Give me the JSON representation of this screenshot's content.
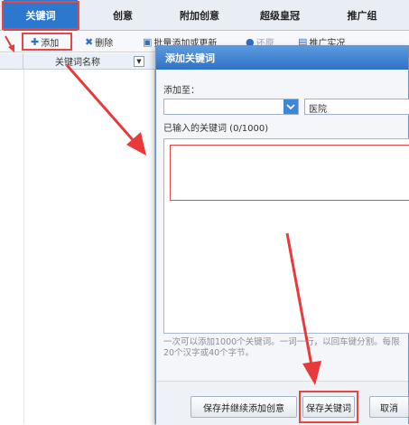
{
  "tabs": [
    {
      "label": "关键词",
      "active": true
    },
    {
      "label": "创意",
      "active": false
    },
    {
      "label": "附加创意",
      "active": false
    },
    {
      "label": "超级皇冠",
      "active": false
    },
    {
      "label": "推广组",
      "active": false
    }
  ],
  "toolbar": {
    "add_label": "添加",
    "add_icon": "plus-icon",
    "delete_label": "删除",
    "delete_icon": "x-icon",
    "batch_label": "批量添加或更新",
    "restore_label": "还原",
    "report_label": "推广实况"
  },
  "grid": {
    "column_header": "关键词名称"
  },
  "dialog": {
    "title": "添加关键词",
    "add_to_label": "添加至：",
    "plan_value": "",
    "unit_value": "医院",
    "entered_label": "已输入的关键词 (0/1000)",
    "keywords_value": "",
    "hint_text": "一次可以添加1000个关键词。一词一行，以回车键分割。每限20个汉字或40个字节。",
    "save_continue_label": "保存并继续添加创意",
    "save_label": "保存关键词",
    "cancel_label": "取消"
  },
  "colors": {
    "accent": "#2c78cf",
    "highlight": "#e84545",
    "arrow": "#e83a3a"
  }
}
